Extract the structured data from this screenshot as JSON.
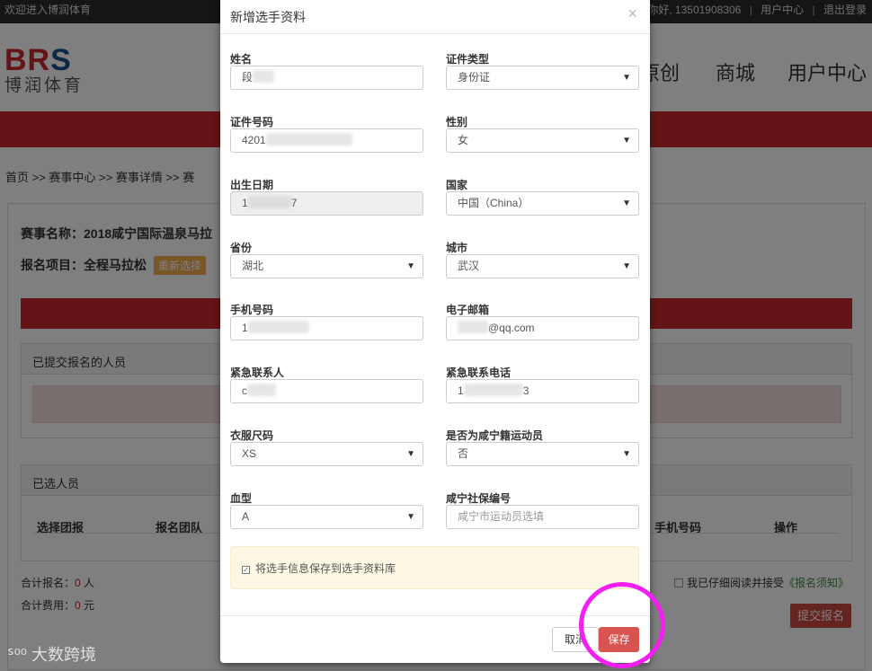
{
  "topbar": {
    "welcome": "欢迎进入博润体育",
    "greeting": "你好, 13501908306",
    "user_center": "用户中心",
    "logout": "退出登录"
  },
  "brand": {
    "logo_en_1": "BR",
    "logo_en_2": "S",
    "logo_cn": "博润体育"
  },
  "nav": {
    "items": [
      "原创",
      "商城",
      "用户中心"
    ]
  },
  "breadcrumb": "首页 >> 赛事中心 >> 赛事详情 >> 赛",
  "event": {
    "name_line": "赛事名称：2018咸宁国际温泉马拉",
    "project_line": "报名项目：全程马拉松",
    "reselect": "重新选择"
  },
  "panels": {
    "submitted": "已提交报名的人员",
    "selected": "已选人员",
    "headers": [
      "选择团报",
      "报名团队",
      "手机号码",
      "操作"
    ]
  },
  "summary": {
    "count_label": "合计报名：",
    "count_value": "0",
    "count_unit": " 人",
    "fee_label": "合计费用：",
    "fee_value": "0",
    "fee_unit": " 元"
  },
  "agreement": {
    "text": "我已仔细阅读并接受",
    "link": "《报名须知》"
  },
  "submit_label": "提交报名",
  "modal": {
    "title": "新增选手资料",
    "close": "×",
    "fields": {
      "name_label": "姓名",
      "name_value": "段",
      "idtype_label": "证件类型",
      "idtype_value": "身份证",
      "idnum_label": "证件号码",
      "idnum_value": "4201",
      "gender_label": "性别",
      "gender_value": "女",
      "birth_label": "出生日期",
      "birth_value_a": "1",
      "birth_value_b": "7",
      "country_label": "国家",
      "country_value": "中国（China）",
      "province_label": "省份",
      "province_value": "湖北",
      "city_label": "城市",
      "city_value": "武汉",
      "phone_label": "手机号码",
      "phone_value": "1",
      "email_label": "电子邮箱",
      "email_value": "@qq.com",
      "emergency_label": "紧急联系人",
      "emergency_value": "c",
      "emergency_phone_label": "紧急联系电话",
      "emergency_phone_value_a": "1",
      "emergency_phone_value_b": "3",
      "size_label": "衣服尺码",
      "size_value": "XS",
      "local_label": "是否为咸宁籍运动员",
      "local_value": "否",
      "blood_label": "血型",
      "blood_value": "A",
      "ssn_label": "咸宁社保编号",
      "ssn_placeholder": "咸宁市运动员选填"
    },
    "save_to_library": "将选手信息保存到选手资料库",
    "cancel": "取消",
    "save": "保存"
  },
  "watermark": "大数跨境",
  "colors": {
    "brand_red": "#c8282d",
    "save_red": "#d9534f",
    "highlight": "#f21ef2"
  }
}
